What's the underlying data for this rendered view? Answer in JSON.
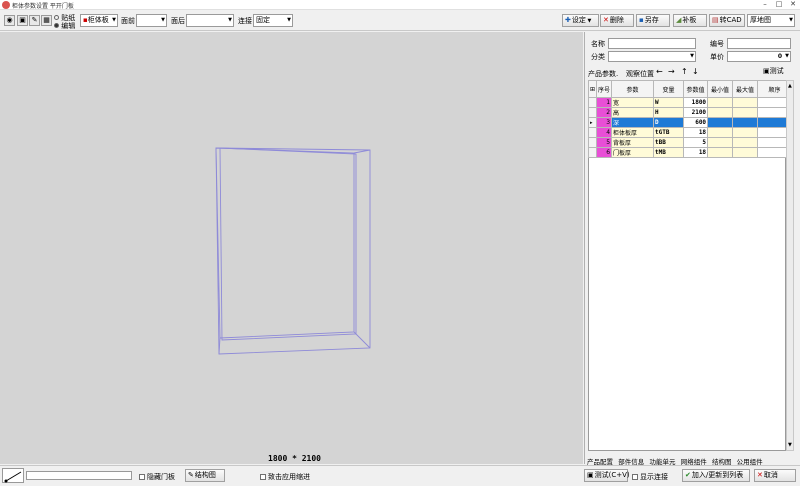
{
  "window": {
    "title": "柜体参数设置 平开门板"
  },
  "toolbar": {
    "radio_labels": [
      "贴纸",
      "编辑"
    ],
    "board_select": "柜体板",
    "front_label": "面前",
    "front_value": "",
    "back_label": "面后",
    "back_value": "",
    "connect_label": "连接",
    "connect_value": "固定",
    "settings_label": "设定",
    "delete_label": "删除",
    "save_as_label": "另存",
    "patch_label": "补板",
    "to_cad_label": "转CAD",
    "view_select": "厚地图"
  },
  "viewport": {
    "dimensions_text": "1800 * 2100"
  },
  "panel": {
    "name_label": "名称",
    "code_label": "编号",
    "category_label": "分类",
    "unit_label": "单价",
    "unit_value": "0",
    "params_label": "产品参数.",
    "observe_label": "观察位置",
    "test_label": "测试",
    "grid": {
      "headers": [
        "序号",
        "参数",
        "变量",
        "参数值",
        "最小值",
        "最大值",
        "顺序"
      ],
      "rows": [
        [
          "1",
          "宽",
          "W",
          "1800",
          "",
          "",
          ""
        ],
        [
          "2",
          "高",
          "H",
          "2100",
          "",
          "",
          ""
        ],
        [
          "3",
          "深",
          "D",
          "600",
          "",
          "",
          ""
        ],
        [
          "4",
          "柜体板厚",
          "tGTB",
          "18",
          "",
          "",
          ""
        ],
        [
          "5",
          "背板厚",
          "tBB",
          "5",
          "",
          "",
          ""
        ],
        [
          "6",
          "门板厚",
          "tMB",
          "18",
          "",
          "",
          ""
        ]
      ],
      "selected_index": 2
    },
    "tabs": [
      "产品配置",
      "部件信息",
      "功能单元",
      "网络组件",
      "结构图",
      "公用组件"
    ]
  },
  "statusbar": {
    "hide_door_label": "隐藏门板",
    "structure_label": "结构图",
    "apply_shrink_label": "致击应用缩进",
    "test_cv_label": "测试(C+V)",
    "show_connect_label": "显示连接",
    "add_update_label": "加入/更新到列表",
    "cancel_label": "取消"
  }
}
